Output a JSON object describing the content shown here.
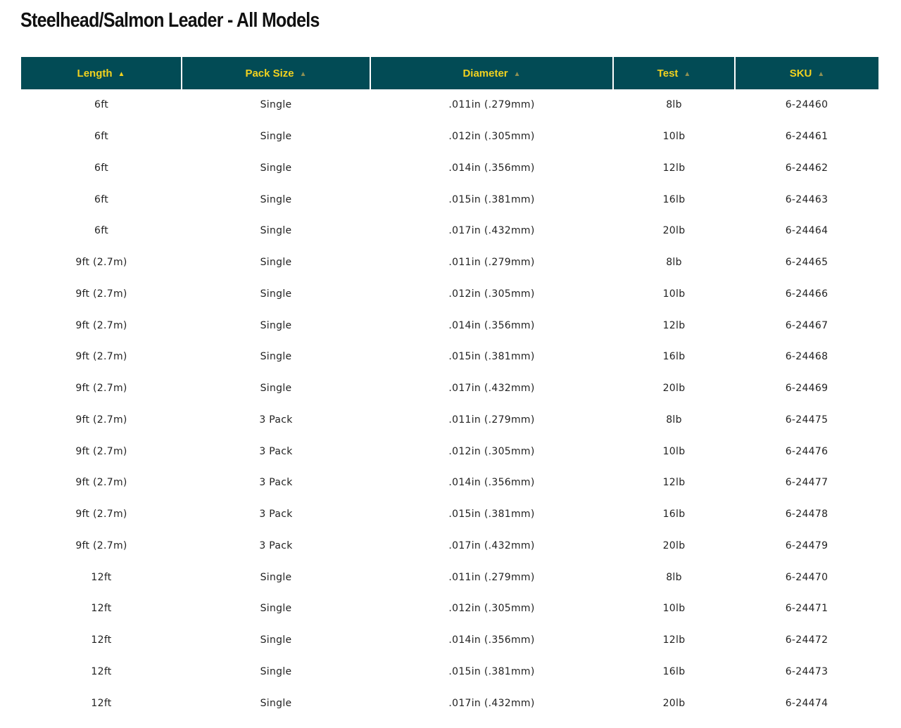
{
  "page": {
    "title": "Steelhead/Salmon Leader - All Models"
  },
  "table": {
    "headers": [
      {
        "label": "Length",
        "sort_icon": "triangle-up-icon",
        "active": true
      },
      {
        "label": "Pack Size",
        "sort_icon": "triangle-up-icon",
        "active": false
      },
      {
        "label": "Diameter",
        "sort_icon": "triangle-up-icon",
        "active": false
      },
      {
        "label": "Test",
        "sort_icon": "triangle-up-icon",
        "active": false
      },
      {
        "label": "SKU",
        "sort_icon": "triangle-up-icon",
        "active": false
      }
    ],
    "sort_arrow": "▲",
    "rows": [
      [
        "6ft",
        "Single",
        ".011in (.279mm)",
        "8lb",
        "6-24460"
      ],
      [
        "6ft",
        "Single",
        ".012in (.305mm)",
        "10lb",
        "6-24461"
      ],
      [
        "6ft",
        "Single",
        ".014in (.356mm)",
        "12lb",
        "6-24462"
      ],
      [
        "6ft",
        "Single",
        ".015in (.381mm)",
        "16lb",
        "6-24463"
      ],
      [
        "6ft",
        "Single",
        ".017in (.432mm)",
        "20lb",
        "6-24464"
      ],
      [
        "9ft (2.7m)",
        "Single",
        ".011in (.279mm)",
        "8lb",
        "6-24465"
      ],
      [
        "9ft (2.7m)",
        "Single",
        ".012in (.305mm)",
        "10lb",
        "6-24466"
      ],
      [
        "9ft (2.7m)",
        "Single",
        ".014in (.356mm)",
        "12lb",
        "6-24467"
      ],
      [
        "9ft (2.7m)",
        "Single",
        ".015in (.381mm)",
        "16lb",
        "6-24468"
      ],
      [
        "9ft (2.7m)",
        "Single",
        ".017in (.432mm)",
        "20lb",
        "6-24469"
      ],
      [
        "9ft (2.7m)",
        "3 Pack",
        ".011in (.279mm)",
        "8lb",
        "6-24475"
      ],
      [
        "9ft (2.7m)",
        "3 Pack",
        ".012in (.305mm)",
        "10lb",
        "6-24476"
      ],
      [
        "9ft (2.7m)",
        "3 Pack",
        ".014in (.356mm)",
        "12lb",
        "6-24477"
      ],
      [
        "9ft (2.7m)",
        "3 Pack",
        ".015in (.381mm)",
        "16lb",
        "6-24478"
      ],
      [
        "9ft (2.7m)",
        "3 Pack",
        ".017in (.432mm)",
        "20lb",
        "6-24479"
      ],
      [
        "12ft",
        "Single",
        ".011in (.279mm)",
        "8lb",
        "6-24470"
      ],
      [
        "12ft",
        "Single",
        ".012in (.305mm)",
        "10lb",
        "6-24471"
      ],
      [
        "12ft",
        "Single",
        ".014in (.356mm)",
        "12lb",
        "6-24472"
      ],
      [
        "12ft",
        "Single",
        ".015in (.381mm)",
        "16lb",
        "6-24473"
      ],
      [
        "12ft",
        "Single",
        ".017in (.432mm)",
        "20lb",
        "6-24474"
      ]
    ]
  },
  "colors": {
    "header_bg": "#024b55",
    "header_text": "#f2d21f",
    "sort_arrow_inactive": "#8d8f54",
    "body_text": "#222222"
  }
}
